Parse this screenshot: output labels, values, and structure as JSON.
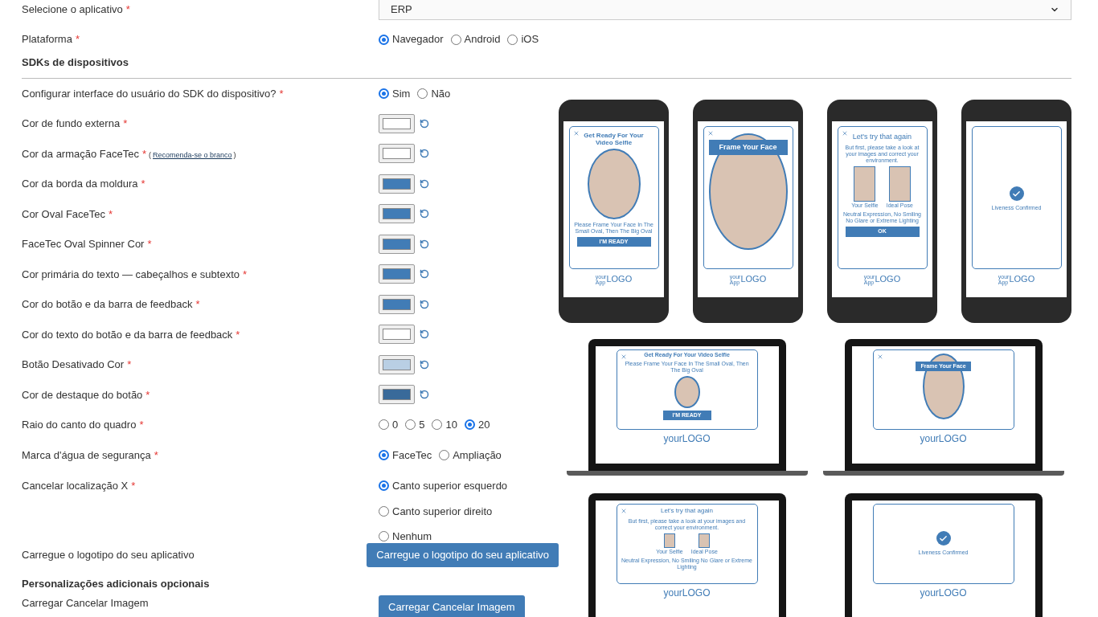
{
  "app_select": {
    "label": "Selecione o aplicativo",
    "req": "*",
    "value": "ERP"
  },
  "platform": {
    "label": "Plataforma",
    "req": "*",
    "options": [
      {
        "label": "Navegador",
        "selected": true
      },
      {
        "label": "Android",
        "selected": false
      },
      {
        "label": "iOS",
        "selected": false
      }
    ]
  },
  "section_title": "SDKs de dispositivos",
  "rows": [
    {
      "kind": "radio",
      "label": "Configurar interface do usuário do SDK do dispositivo?",
      "req": "*",
      "options": [
        {
          "label": "Sim",
          "selected": true
        },
        {
          "label": "Não",
          "selected": false
        }
      ]
    },
    {
      "kind": "color",
      "label": "Cor de fundo externa",
      "req": "*",
      "color": "#ffffff"
    },
    {
      "kind": "color",
      "label": "Cor da armação FaceTec",
      "req": "*",
      "note": {
        "open": "(",
        "link": "Recomenda-se o branco",
        "close": ")"
      },
      "color": "#ffffff"
    },
    {
      "kind": "color",
      "label": "Cor da borda da moldura",
      "req": "*",
      "color": "#417cb6"
    },
    {
      "kind": "color",
      "label": "Cor Oval FaceTec",
      "req": "*",
      "color": "#417cb6"
    },
    {
      "kind": "color",
      "label": "FaceTec Oval Spinner Cor",
      "req": "*",
      "color": "#417cb6"
    },
    {
      "kind": "color",
      "label": "Cor primária do texto — cabeçalhos e subtexto",
      "req": "*",
      "color": "#417cb6"
    },
    {
      "kind": "color",
      "label": "Cor do botão e da barra de feedback",
      "req": "*",
      "color": "#417cb6"
    },
    {
      "kind": "color",
      "label": "Cor do texto do botão e da barra de feedback",
      "req": "*",
      "color": "#ffffff"
    },
    {
      "kind": "color",
      "label": "Botão Desativado Cor",
      "req": "*",
      "color": "#b9cfe4"
    },
    {
      "kind": "color",
      "label": "Cor de destaque do botão",
      "req": "*",
      "color": "#396a9a"
    },
    {
      "kind": "radio",
      "label": "Raio do canto do quadro",
      "req": "*",
      "options": [
        {
          "label": "0",
          "selected": false
        },
        {
          "label": "5",
          "selected": false
        },
        {
          "label": "10",
          "selected": false
        },
        {
          "label": "20",
          "selected": true
        }
      ]
    },
    {
      "kind": "radio",
      "label": "Marca d'água de segurança",
      "req": "*",
      "options": [
        {
          "label": "FaceTec",
          "selected": true
        },
        {
          "label": "Ampliação",
          "selected": false
        }
      ]
    },
    {
      "kind": "radio_vertical",
      "label": "Cancelar localização X",
      "req": "*",
      "options": [
        {
          "label": "Canto superior esquerdo",
          "selected": true
        },
        {
          "label": "Canto superior direito",
          "selected": false
        },
        {
          "label": "Nenhum",
          "selected": false
        }
      ]
    },
    {
      "kind": "upload",
      "label": "Carregue o logotipo do seu aplicativo",
      "button": "Carregue o logotipo do seu aplicativo"
    },
    {
      "kind": "heading",
      "label": "Personalizações adicionais opcionais"
    },
    {
      "kind": "upload",
      "label": "Carregar Cancelar Imagem",
      "button": "Carregar Cancelar Imagem"
    }
  ],
  "phones": [
    {
      "kind": "ready",
      "title": "Get Ready For Your Video Selfie",
      "text": "Please Frame Your Face In The Small Oval, Then The Big Oval",
      "button": "I'M READY",
      "logo_small": [
        "your",
        "App"
      ],
      "logo": "LOGO"
    },
    {
      "kind": "frame",
      "banner": "Frame Your Face",
      "logo_small": [
        "your",
        "App"
      ],
      "logo": "LOGO"
    },
    {
      "kind": "retry",
      "title": "Let's try that again",
      "text": "But first, please take a look at your images and correct your environment.",
      "captions": [
        "Your Selfie",
        "Ideal Pose"
      ],
      "tips": "Neutral Expression, No Smiling No Glare or Extreme Lighting",
      "button": "OK",
      "logo_small": [
        "your",
        "App"
      ],
      "logo": "LOGO"
    },
    {
      "kind": "confirmed",
      "text": "Liveness Confirmed",
      "logo_small": [
        "your",
        "App"
      ],
      "logo": "LOGO"
    }
  ],
  "laptops": [
    {
      "kind": "ready",
      "title": "Get Ready For Your Video Selfie",
      "text": "Please Frame Your Face In The Small Oval, Then The Big Oval",
      "button": "I'M READY",
      "logo": "yourLOGO"
    },
    {
      "kind": "frame",
      "banner": "Frame Your Face",
      "logo": "yourLOGO"
    },
    {
      "kind": "retry",
      "title": "Let's try that again",
      "text": "But first, please take a look at your images and correct your environment.",
      "captions": [
        "Your Selfie",
        "Ideal Pose"
      ],
      "tips": "Neutral Expression, No Smiling No Glare or Extreme Lighting",
      "logo": "yourLOGO"
    },
    {
      "kind": "confirmed",
      "text": "Liveness Confirmed",
      "logo": "yourLOGO"
    }
  ]
}
